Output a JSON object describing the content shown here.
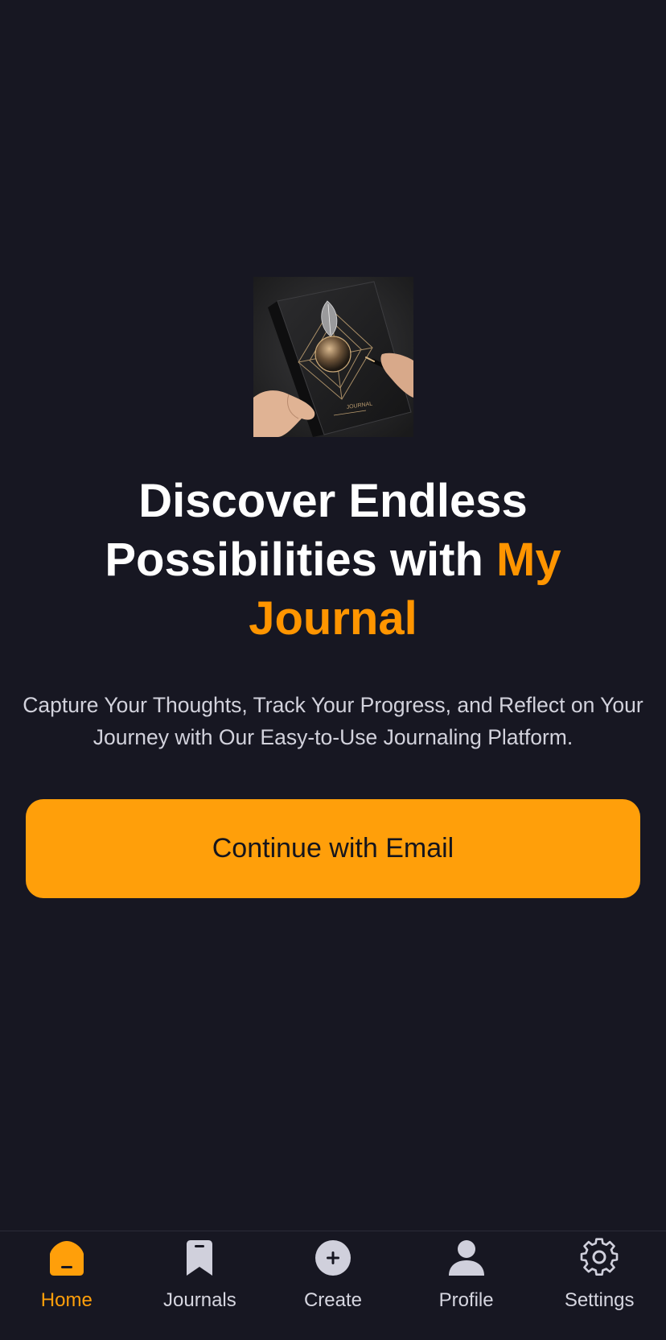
{
  "hero": {
    "image_label": "JOURNAL",
    "headline_part1": "Discover Endless Possibilities with",
    "headline_accent": "My Journal",
    "subtitle": "Capture Your Thoughts, Track Your Progress, and Reflect on Your Journey with Our Easy-to-Use Journaling Platform.",
    "cta_label": "Continue with Email"
  },
  "tabs": [
    {
      "label": "Home",
      "icon": "home-icon",
      "active": true
    },
    {
      "label": "Journals",
      "icon": "bookmark-icon",
      "active": false
    },
    {
      "label": "Create",
      "icon": "plus-circle-icon",
      "active": false
    },
    {
      "label": "Profile",
      "icon": "person-icon",
      "active": false
    },
    {
      "label": "Settings",
      "icon": "gear-icon",
      "active": false
    }
  ],
  "colors": {
    "background": "#171722",
    "accent": "#ff9500",
    "button": "#ff9f0a",
    "button_text": "#15151d",
    "inactive_icon": "#d0d0dc"
  }
}
